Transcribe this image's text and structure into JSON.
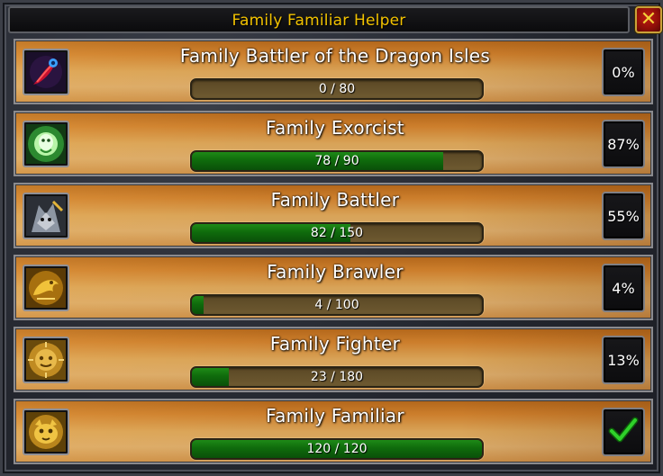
{
  "window": {
    "title": "Family Familiar Helper",
    "close_icon": "close-x-icon"
  },
  "rows": [
    {
      "name": "Family Battler of the Dragon Isles",
      "progress_text": "0 / 80",
      "current": 0,
      "total": 80,
      "percent_text": "0%",
      "icon": "phoenix-feather-icon",
      "complete": false
    },
    {
      "name": "Family Exorcist",
      "progress_text": "78 / 90",
      "current": 78,
      "total": 90,
      "percent_text": "87%",
      "icon": "spirit-ghost-icon",
      "complete": false
    },
    {
      "name": "Family Battler",
      "progress_text": "82 / 150",
      "current": 82,
      "total": 150,
      "percent_text": "55%",
      "icon": "battle-wolf-icon",
      "complete": false
    },
    {
      "name": "Family Brawler",
      "progress_text": "4 / 100",
      "current": 4,
      "total": 100,
      "percent_text": "4%",
      "icon": "golden-dragon-icon",
      "complete": false
    },
    {
      "name": "Family Fighter",
      "progress_text": "23 / 180",
      "current": 23,
      "total": 180,
      "percent_text": "13%",
      "icon": "golden-sun-face-icon",
      "complete": false
    },
    {
      "name": "Family Familiar",
      "progress_text": "120 / 120",
      "current": 120,
      "total": 120,
      "percent_text": "",
      "icon": "golden-pet-icon",
      "complete": true
    }
  ],
  "colors": {
    "title": "#f2c200",
    "progress_fill": "#0f6b0c",
    "checkmark": "#2fd12a"
  }
}
